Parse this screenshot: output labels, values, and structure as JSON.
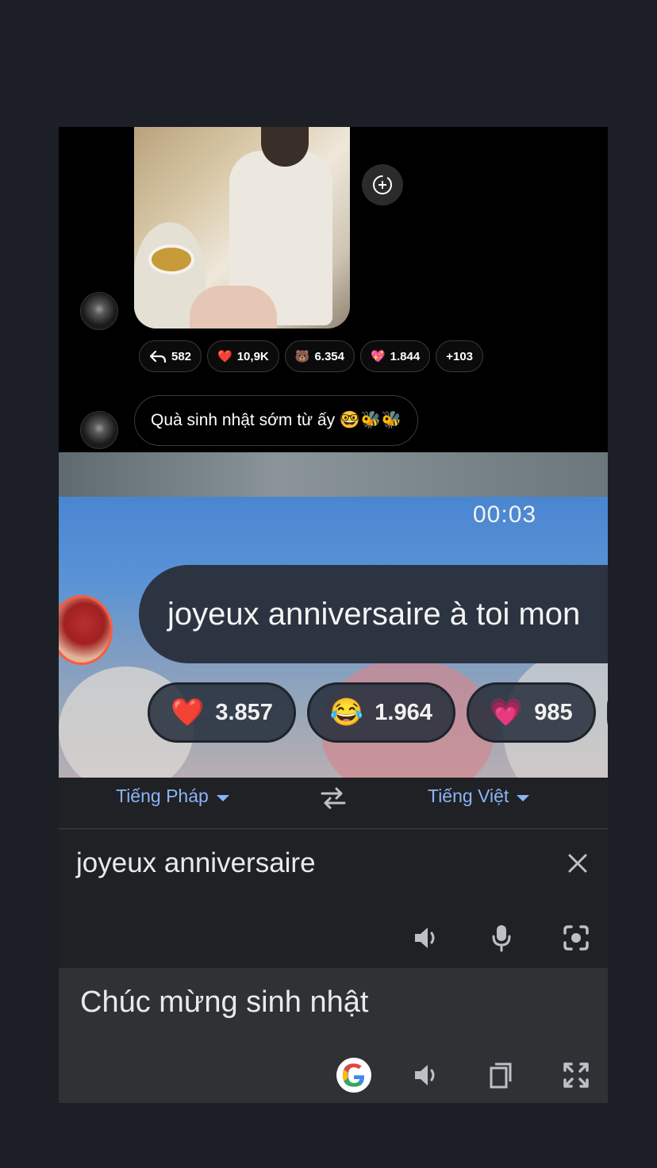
{
  "chat": {
    "reactions": [
      {
        "icon": "reply-icon",
        "emoji": "↩",
        "count": "582"
      },
      {
        "icon": "heart-icon",
        "emoji": "❤️",
        "count": "10,9K"
      },
      {
        "icon": "bear-icon",
        "emoji": "🐻",
        "count": "6.354"
      },
      {
        "icon": "sparkling-heart-icon",
        "emoji": "💖",
        "count": "1.844"
      },
      {
        "icon": "more",
        "emoji": "",
        "count": "+103"
      }
    ],
    "message": "Quà sinh nhật sớm từ ấy 🤓🐝🐝"
  },
  "zoomed": {
    "time": "00:03",
    "message": "joyeux anniversaire à toi mon",
    "reactions": [
      {
        "icon": "heart-icon",
        "emoji": "❤️",
        "count": "3.857"
      },
      {
        "icon": "laughing-icon",
        "emoji": "😂",
        "count": "1.964"
      },
      {
        "icon": "pink-heart-icon",
        "emoji": "💗",
        "count": "985"
      }
    ]
  },
  "translate": {
    "source_lang": "Tiếng Pháp",
    "target_lang": "Tiếng Việt",
    "source_text": "joyeux anniversaire",
    "result_text": "Chúc mừng sinh nhật"
  }
}
